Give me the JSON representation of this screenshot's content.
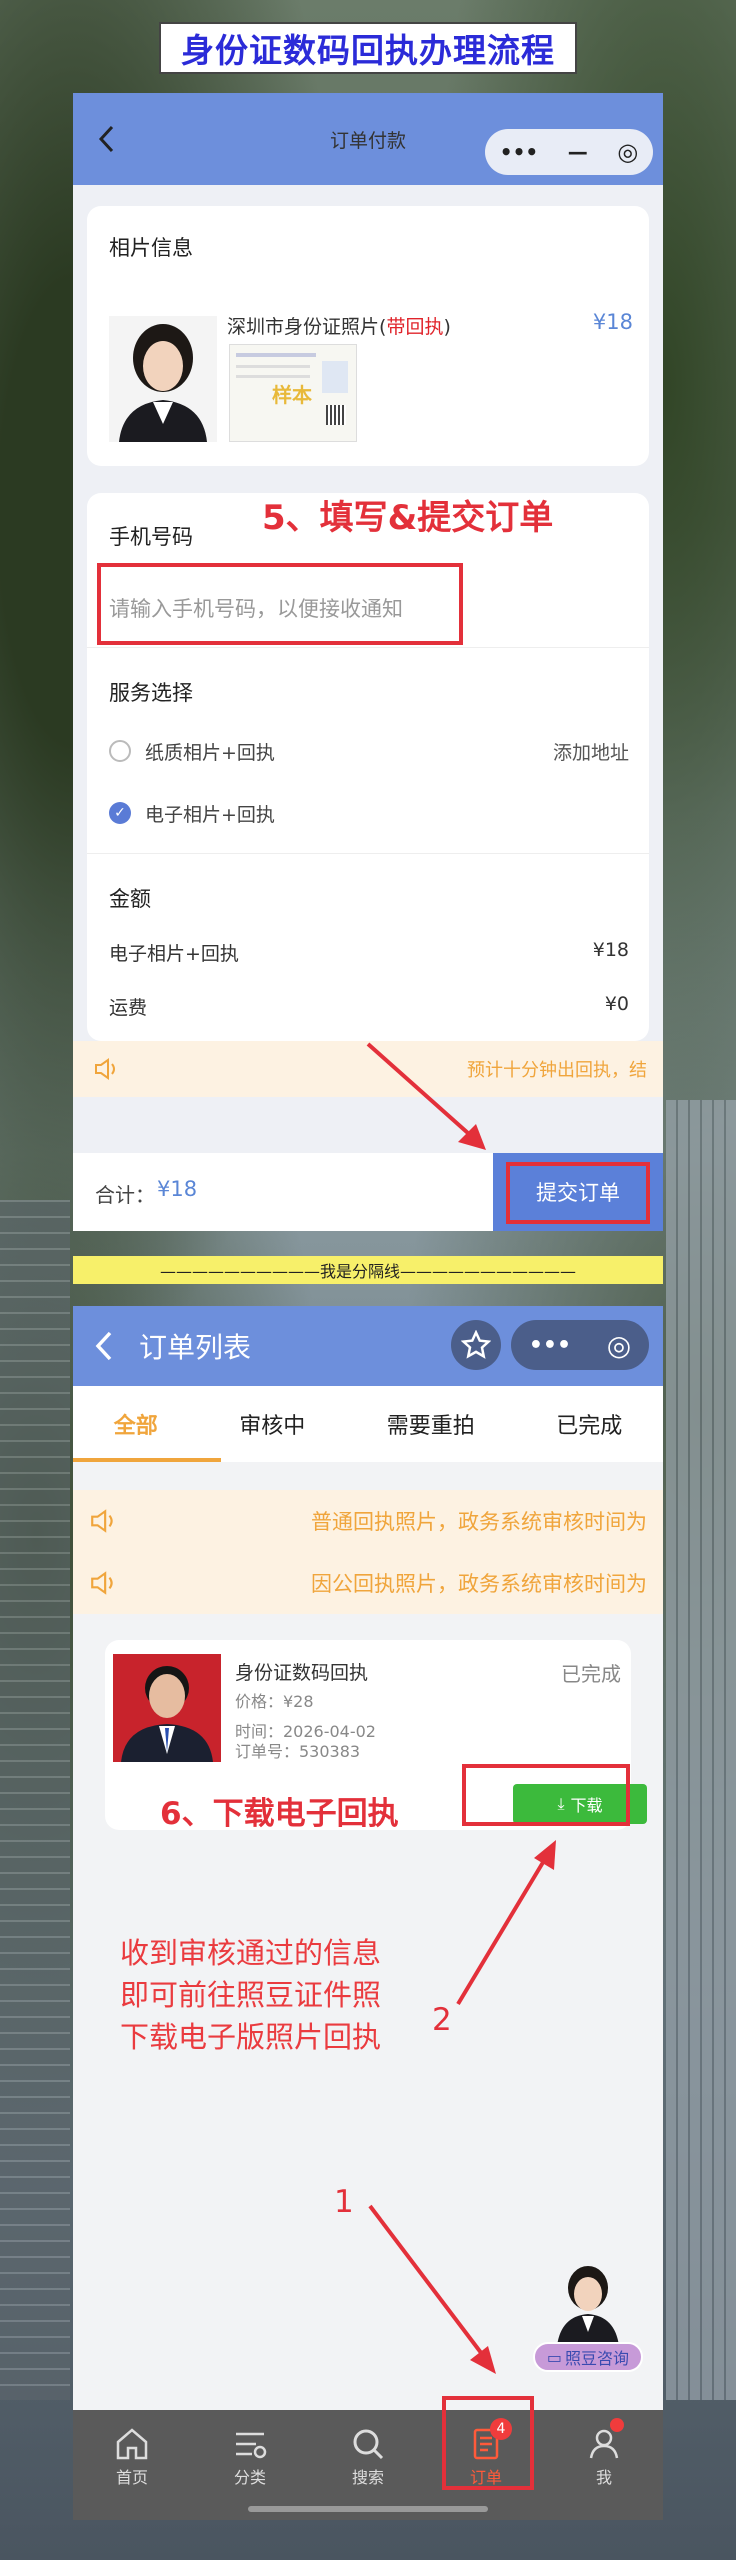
{
  "banner_title": "身份证数码回执办理流程",
  "order_pay": {
    "nav_title": "订单付款",
    "capsule": [
      "•••",
      "—",
      "◎"
    ],
    "photo_section": {
      "heading": "相片信息",
      "product": "深圳市身份证照片",
      "product_tag_open": "(",
      "product_tag": "带回执",
      "product_tag_close": ")",
      "price": "¥18",
      "sample_stamp": "样本"
    },
    "phone_section": {
      "heading": "手机号码",
      "placeholder": "请输入手机号码，以便接收通知"
    },
    "service_section": {
      "heading": "服务选择",
      "options": [
        {
          "label": "纸质相片+回执",
          "selected": false,
          "extra": "添加地址"
        },
        {
          "label": "电子相片+回执",
          "selected": true,
          "extra": ""
        }
      ]
    },
    "amount_section": {
      "heading": "金额",
      "rows": [
        {
          "label": "电子相片+回执",
          "value": "¥18"
        },
        {
          "label": "运费",
          "value": "¥0"
        }
      ]
    },
    "notice": "预计十分钟出回执，结",
    "footer": {
      "total_label": "合计：",
      "total_value": "¥18",
      "submit": "提交订单"
    }
  },
  "annotation_step5": "5、填写&提交订单",
  "divider": "——————————我是分隔线———————————",
  "order_list": {
    "nav_title": "订单列表",
    "capsule": [
      "•••",
      "◎"
    ],
    "tabs": [
      "全部",
      "审核中",
      "需要重拍",
      "已完成"
    ],
    "notices": [
      "普通回执照片，政务系统审核时间为",
      "因公回执照片，政务系统审核时间为"
    ],
    "order": {
      "title": "身份证数码回执",
      "status": "已完成",
      "price": "价格：¥28",
      "time": "时间：2026-04-02",
      "order_no": "订单号：530383",
      "download": "下载"
    },
    "tabbar": [
      {
        "label": "首页",
        "icon": "home-icon"
      },
      {
        "label": "分类",
        "icon": "category-icon"
      },
      {
        "label": "搜索",
        "icon": "search-icon"
      },
      {
        "label": "订单",
        "icon": "order-icon",
        "badge": "4"
      },
      {
        "label": "我",
        "icon": "user-icon"
      }
    ],
    "consult": "照豆咨询"
  },
  "annotation_step6": "6、下载电子回执",
  "annotation_info": [
    "收到审核通过的信息",
    "即可前往照豆证件照",
    "下载电子版照片回执"
  ],
  "annotation_num1": "1",
  "annotation_num2": "2",
  "colors": {
    "nav": "#6d8fdc",
    "accent": "#f0a53c",
    "annotation": "#e3303a",
    "download": "#3cba3c"
  }
}
